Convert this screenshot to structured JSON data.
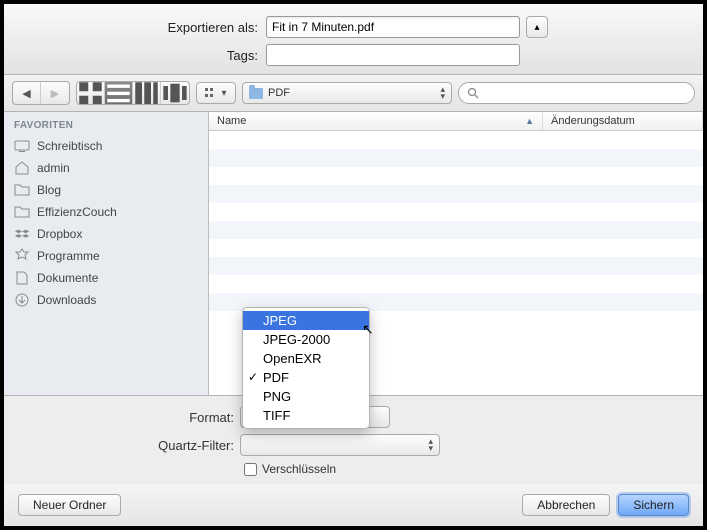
{
  "export": {
    "label": "Exportieren als:",
    "value": "Fit in 7 Minuten.pdf"
  },
  "tags": {
    "label": "Tags:"
  },
  "path": {
    "current": "PDF"
  },
  "sidebar": {
    "heading": "FAVORITEN",
    "items": [
      {
        "label": "Schreibtisch"
      },
      {
        "label": "admin"
      },
      {
        "label": "Blog"
      },
      {
        "label": "EffizienzCouch"
      },
      {
        "label": "Dropbox"
      },
      {
        "label": "Programme"
      },
      {
        "label": "Dokumente"
      },
      {
        "label": "Downloads"
      }
    ]
  },
  "columns": {
    "name": "Name",
    "date": "Änderungsdatum"
  },
  "format": {
    "label": "Format:"
  },
  "quartz": {
    "label": "Quartz-Filter:"
  },
  "encrypt": {
    "label": "Verschlüsseln"
  },
  "dropdown": {
    "items": [
      {
        "label": "JPEG",
        "highlight": true
      },
      {
        "label": "JPEG-2000"
      },
      {
        "label": "OpenEXR"
      },
      {
        "label": "PDF",
        "checked": true
      },
      {
        "label": "PNG"
      },
      {
        "label": "TIFF"
      }
    ]
  },
  "buttons": {
    "newFolder": "Neuer Ordner",
    "cancel": "Abbrechen",
    "save": "Sichern"
  }
}
